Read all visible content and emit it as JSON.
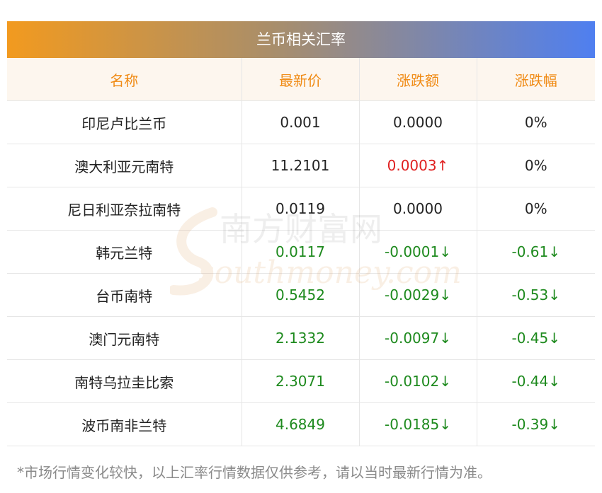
{
  "title": "兰币相关汇率",
  "columns": [
    "名称",
    "最新价",
    "涨跌额",
    "涨跌幅"
  ],
  "rows": [
    {
      "name": "印尼卢比兰币",
      "price": "0.001",
      "change": "0.0000",
      "pct": "0%",
      "trend": "flat"
    },
    {
      "name": "澳大利亚元南特",
      "price": "11.2101",
      "change": "0.0003↑",
      "pct": "0%",
      "trend": "up"
    },
    {
      "name": "尼日利亚奈拉南特",
      "price": "0.0119",
      "change": "0.0000",
      "pct": "0%",
      "trend": "flat"
    },
    {
      "name": "韩元兰特",
      "price": "0.0117",
      "change": "-0.0001↓",
      "pct": "-0.61↓",
      "trend": "down"
    },
    {
      "name": "台币南特",
      "price": "0.5452",
      "change": "-0.0029↓",
      "pct": "-0.53↓",
      "trend": "down"
    },
    {
      "name": "澳门元南特",
      "price": "2.1332",
      "change": "-0.0097↓",
      "pct": "-0.45↓",
      "trend": "down"
    },
    {
      "name": "南特乌拉圭比索",
      "price": "2.3071",
      "change": "-0.0102↓",
      "pct": "-0.44↓",
      "trend": "down"
    },
    {
      "name": "波币南非兰特",
      "price": "4.6849",
      "change": "-0.0185↓",
      "pct": "-0.39↓",
      "trend": "down"
    }
  ],
  "footnote": "*市场行情变化较快，以上汇率行情数据仅供参考，请以当时最新行情为准。",
  "watermark": {
    "cn": "南方财富网",
    "en": "southmoney.com"
  }
}
